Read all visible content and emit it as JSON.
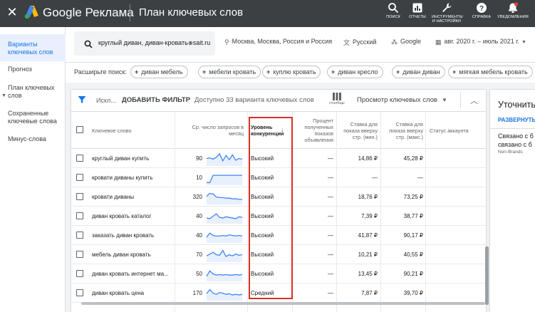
{
  "topbar": {
    "brand": "Google Реклама",
    "page_title": "План ключевых слов",
    "buttons": [
      {
        "label": "ПОИСК",
        "icon": "search-icon"
      },
      {
        "label": "ОТЧЕТЫ",
        "icon": "reports-icon"
      },
      {
        "label": "ИНСТРУМЕНТЫ И НАСТРОЙКИ",
        "icon": "wrench-icon"
      },
      {
        "label": "СПРАВКА",
        "icon": "help-icon"
      },
      {
        "label": "УВЕДОМЛЕНИЯ",
        "icon": "bell-icon"
      }
    ],
    "close_glyph": "✕"
  },
  "sidenav": {
    "items": [
      {
        "label": "Варианты ключевых слов",
        "active": true
      },
      {
        "label": "Прогноз",
        "active": false
      },
      {
        "label": "План ключевых слов",
        "active": false
      },
      {
        "label": "Сохраненные ключевые слова",
        "active": false
      },
      {
        "label": "Минус-слова",
        "active": false
      }
    ]
  },
  "filters": {
    "query": "круглый диван, диван-кровать",
    "site": "sait.ru",
    "location": "Москва, Москва, Россия и Россия",
    "language": "Русский",
    "network": "Google",
    "period": "авг. 2020 г. – июль 2021 г."
  },
  "expand": {
    "label": "Расширьте поиск:",
    "chips": [
      "диван мебель",
      "мебели кровать",
      "куплю кровать",
      "диван кресло",
      "диван диван",
      "мягкая мебель кровать"
    ]
  },
  "toolbar": {
    "exclude": "Искл...",
    "add_filter": "ДОБАВИТЬ ФИЛЬТР",
    "available": "Доступно 33 варианта ключевых слов",
    "columns": "столбцы",
    "view": "Просмотр ключевых слов"
  },
  "columns": {
    "keyword": "Ключевое слово",
    "searches": "Ср. число запросов в месяц",
    "competition": "Уровень конкуренции",
    "impression_share": "Процент полученных показов объявления",
    "bid_low": "Ставка для показа вверху стр. (мин.)",
    "bid_high": "Ставка для показа вверху стр. (макс.)",
    "account_status": "Статус аккаунта"
  },
  "rows": [
    {
      "keyword": "круглый диван купить",
      "searches": "90",
      "competition": "Высокий",
      "impression_share": "—",
      "bid_low": "14,86 ₽",
      "bid_high": "45,28 ₽",
      "trend": [
        0.5,
        0.55,
        0.45,
        0.6,
        0.9,
        0.3,
        0.75,
        0.4,
        0.8,
        0.35,
        0.5,
        0.45
      ]
    },
    {
      "keyword": "кровати диваны купить",
      "searches": "10",
      "competition": "Высокий",
      "impression_share": "—",
      "bid_low": "—",
      "bid_high": "—",
      "trend": [
        0.1,
        0.1,
        0.7,
        0.7,
        0.7,
        0.7,
        0.7,
        0.7,
        0.7,
        0.7,
        0.7,
        0.7
      ]
    },
    {
      "keyword": "кровати диваны",
      "searches": "320",
      "competition": "Высокий",
      "impression_share": "—",
      "bid_low": "18,76 ₽",
      "bid_high": "73,25 ₽",
      "trend": [
        0.55,
        0.8,
        0.75,
        0.5,
        0.45,
        0.45,
        0.4,
        0.4,
        0.35,
        0.35,
        0.3,
        0.3
      ]
    },
    {
      "keyword": "диван кровать каталог",
      "searches": "40",
      "competition": "Высокий",
      "impression_share": "—",
      "bid_low": "7,39 ₽",
      "bid_high": "38,77 ₽",
      "trend": [
        0.35,
        0.3,
        0.5,
        0.7,
        0.4,
        0.35,
        0.45,
        0.4,
        0.35,
        0.3,
        0.45,
        0.4
      ]
    },
    {
      "keyword": "заказать диван кровать",
      "searches": "40",
      "competition": "Высокий",
      "impression_share": "—",
      "bid_low": "41,87 ₽",
      "bid_high": "90,17 ₽",
      "trend": [
        0.35,
        0.7,
        0.5,
        0.45,
        0.45,
        0.5,
        0.45,
        0.55,
        0.5,
        0.45,
        0.5,
        0.45
      ]
    },
    {
      "keyword": "мебель диван кровать",
      "searches": "70",
      "competition": "Высокий",
      "impression_share": "—",
      "bid_low": "10,21 ₽",
      "bid_high": "40,55 ₽",
      "trend": [
        0.4,
        0.55,
        0.7,
        0.5,
        0.45,
        0.85,
        0.35,
        0.5,
        0.4,
        0.55,
        0.45,
        0.5
      ]
    },
    {
      "keyword": "диван кровать интернет ма...",
      "searches": "50",
      "competition": "Высокий",
      "impression_share": "—",
      "bid_low": "13,45 ₽",
      "bid_high": "90,21 ₽",
      "trend": [
        0.3,
        0.75,
        0.5,
        0.4,
        0.45,
        0.4,
        0.45,
        0.4,
        0.4,
        0.45,
        0.4,
        0.45
      ]
    },
    {
      "keyword": "диван кровать цена",
      "searches": "170",
      "competition": "Средний",
      "impression_share": "—",
      "bid_low": "7,87 ₽",
      "bid_high": "39,70 ₽",
      "trend": [
        0.45,
        0.8,
        0.5,
        0.4,
        0.55,
        0.5,
        0.4,
        0.45,
        0.35,
        0.4,
        0.35,
        0.4
      ]
    }
  ],
  "right_panel": {
    "title": "Уточнить",
    "link": "РАЗВЕРНУТЬ",
    "item_line1": "Связано с б",
    "item_line2": "связано с б",
    "item_sub": "Non-Brands"
  },
  "colors": {
    "accent": "#1a73e8",
    "highlight": "#d93025",
    "topbar": "#3c4043",
    "spark": "#4285f4"
  }
}
